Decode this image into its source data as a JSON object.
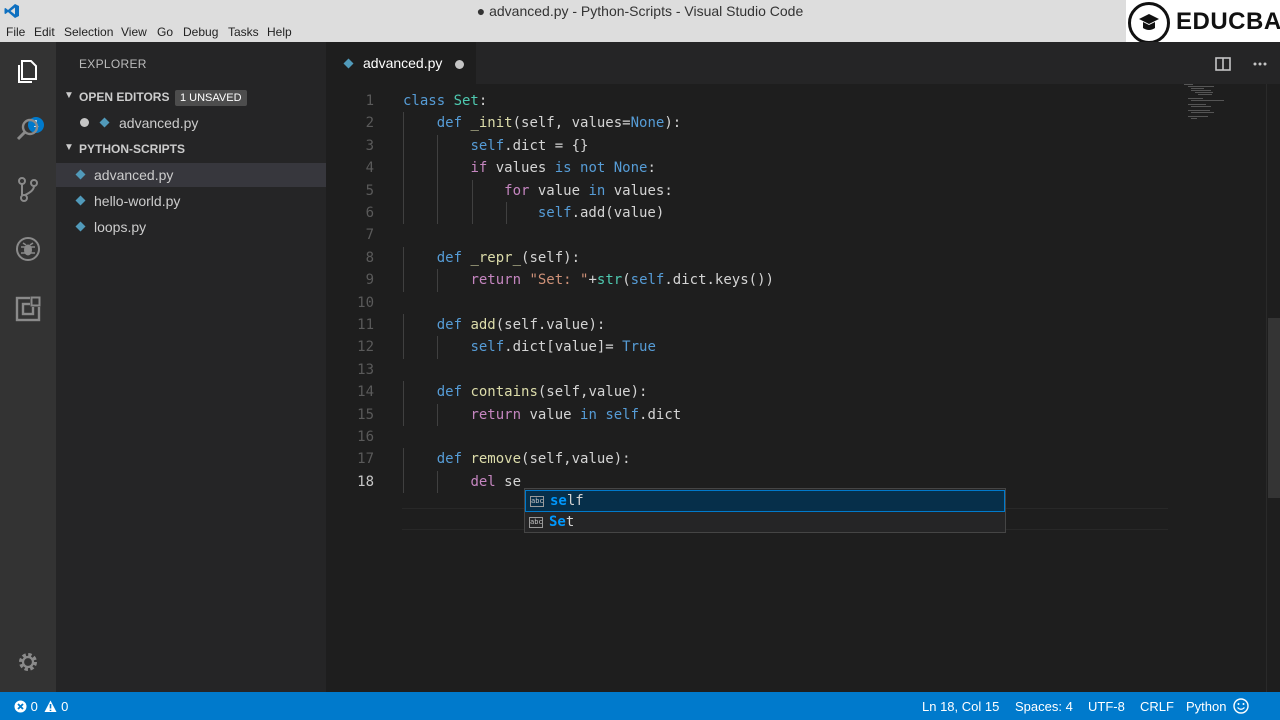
{
  "window": {
    "title": "● advanced.py - Python-Scripts - Visual Studio Code"
  },
  "watermark": {
    "brand": "EDUCBA"
  },
  "menu": [
    "File",
    "Edit",
    "Selection",
    "View",
    "Go",
    "Debug",
    "Tasks",
    "Help"
  ],
  "activity_bar": {
    "items": [
      "explorer-icon",
      "search-icon",
      "source-control-icon",
      "debug-icon",
      "extensions-icon",
      "gear-icon"
    ],
    "explorer_badge": "1"
  },
  "sidebar": {
    "title": "EXPLORER",
    "open_editors": {
      "label": "OPEN EDITORS",
      "badge": "1 UNSAVED",
      "files": [
        "advanced.py"
      ]
    },
    "folder": {
      "label": "PYTHON-SCRIPTS",
      "files": [
        "advanced.py",
        "hello-world.py",
        "loops.py"
      ]
    }
  },
  "editor": {
    "tab_label": "advanced.py",
    "line_numbers": [
      "1",
      "2",
      "3",
      "4",
      "5",
      "6",
      "7",
      "8",
      "9",
      "10",
      "11",
      "12",
      "13",
      "14",
      "15",
      "16",
      "17",
      "18"
    ],
    "lines": [
      [
        {
          "t": "class ",
          "c": "kw"
        },
        {
          "t": "Set",
          "c": "cls"
        },
        {
          "t": ":",
          "c": ""
        }
      ],
      [
        {
          "t": "    ",
          "c": ""
        },
        {
          "t": "def ",
          "c": "kw"
        },
        {
          "t": "_init",
          "c": "fn"
        },
        {
          "t": "(self, values=",
          "c": ""
        },
        {
          "t": "None",
          "c": "kw"
        },
        {
          "t": "):",
          "c": ""
        }
      ],
      [
        {
          "t": "        ",
          "c": ""
        },
        {
          "t": "self",
          "c": "slf"
        },
        {
          "t": ".dict = {}",
          "c": ""
        }
      ],
      [
        {
          "t": "        ",
          "c": ""
        },
        {
          "t": "if",
          "c": "ctl"
        },
        {
          "t": " values ",
          "c": ""
        },
        {
          "t": "is not None",
          "c": "kw"
        },
        {
          "t": ":",
          "c": ""
        }
      ],
      [
        {
          "t": "            ",
          "c": ""
        },
        {
          "t": "for",
          "c": "ctl"
        },
        {
          "t": " value ",
          "c": ""
        },
        {
          "t": "in",
          "c": "kw"
        },
        {
          "t": " values:",
          "c": ""
        }
      ],
      [
        {
          "t": "                ",
          "c": ""
        },
        {
          "t": "self",
          "c": "slf"
        },
        {
          "t": ".add(value)",
          "c": ""
        }
      ],
      [],
      [
        {
          "t": "    ",
          "c": ""
        },
        {
          "t": "def ",
          "c": "kw"
        },
        {
          "t": "_repr_",
          "c": "fn"
        },
        {
          "t": "(self):",
          "c": ""
        }
      ],
      [
        {
          "t": "        ",
          "c": ""
        },
        {
          "t": "return",
          "c": "ctl"
        },
        {
          "t": " ",
          "c": ""
        },
        {
          "t": "\"Set: \"",
          "c": "str"
        },
        {
          "t": "+",
          "c": ""
        },
        {
          "t": "str",
          "c": "cls"
        },
        {
          "t": "(",
          "c": ""
        },
        {
          "t": "self",
          "c": "slf"
        },
        {
          "t": ".dict.keys())",
          "c": ""
        }
      ],
      [],
      [
        {
          "t": "    ",
          "c": ""
        },
        {
          "t": "def ",
          "c": "kw"
        },
        {
          "t": "add",
          "c": "fn"
        },
        {
          "t": "(self.value):",
          "c": ""
        }
      ],
      [
        {
          "t": "        ",
          "c": ""
        },
        {
          "t": "self",
          "c": "slf"
        },
        {
          "t": ".dict[value]= ",
          "c": ""
        },
        {
          "t": "True",
          "c": "kw"
        }
      ],
      [],
      [
        {
          "t": "    ",
          "c": ""
        },
        {
          "t": "def ",
          "c": "kw"
        },
        {
          "t": "contains",
          "c": "fn"
        },
        {
          "t": "(self,value):",
          "c": ""
        }
      ],
      [
        {
          "t": "        ",
          "c": ""
        },
        {
          "t": "return",
          "c": "ctl"
        },
        {
          "t": " value ",
          "c": ""
        },
        {
          "t": "in",
          "c": "kw"
        },
        {
          "t": " ",
          "c": ""
        },
        {
          "t": "self",
          "c": "slf"
        },
        {
          "t": ".dict",
          "c": ""
        }
      ],
      [],
      [
        {
          "t": "    ",
          "c": ""
        },
        {
          "t": "def ",
          "c": "kw"
        },
        {
          "t": "remove",
          "c": "fn"
        },
        {
          "t": "(self,value):",
          "c": ""
        }
      ],
      [
        {
          "t": "        ",
          "c": ""
        },
        {
          "t": "del",
          "c": "ctl"
        },
        {
          "t": " se",
          "c": ""
        }
      ]
    ]
  },
  "suggestions": [
    {
      "match": "se",
      "rest": "lf",
      "kind_icon": "abc"
    },
    {
      "match": "Se",
      "rest": "t",
      "kind_icon": "abc"
    }
  ],
  "status": {
    "errors": "0",
    "warnings": "0",
    "position": "Ln 18, Col 15",
    "indent": "Spaces: 4",
    "encoding": "UTF-8",
    "eol": "CRLF",
    "language": "Python"
  },
  "colors": {
    "accent": "#007acc",
    "keyword": "#569cd6",
    "control": "#c586c0",
    "function": "#dcdcaa",
    "string": "#ce9178",
    "type": "#4ec9b0"
  }
}
